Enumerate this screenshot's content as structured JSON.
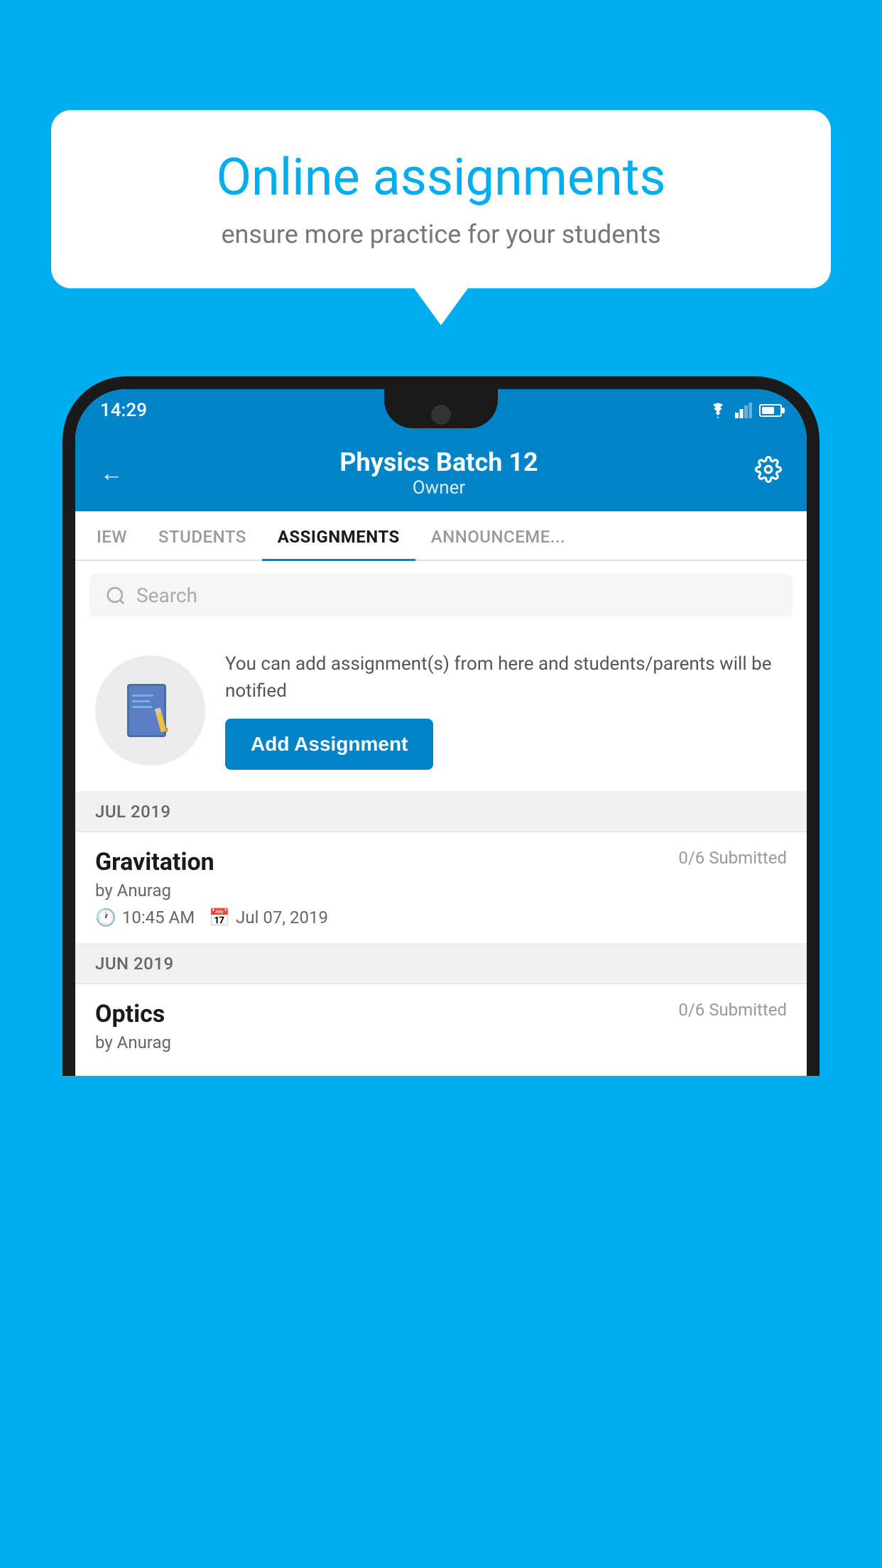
{
  "background_color": "#00AEEF",
  "speech_bubble": {
    "title": "Online assignments",
    "subtitle": "ensure more practice for your students"
  },
  "status_bar": {
    "time": "14:29",
    "wifi": true,
    "signal": true,
    "battery": true
  },
  "header": {
    "title": "Physics Batch 12",
    "subtitle": "Owner",
    "back_label": "←",
    "settings_label": "⚙"
  },
  "tabs": [
    {
      "id": "iew",
      "label": "IEW",
      "active": false
    },
    {
      "id": "students",
      "label": "STUDENTS",
      "active": false
    },
    {
      "id": "assignments",
      "label": "ASSIGNMENTS",
      "active": true
    },
    {
      "id": "announcements",
      "label": "ANNOUNCEMENTS",
      "active": false
    }
  ],
  "search": {
    "placeholder": "Search"
  },
  "info_card": {
    "description": "You can add assignment(s) from here and students/parents will be notified",
    "add_button_label": "Add Assignment"
  },
  "assignment_groups": [
    {
      "month_label": "JUL 2019",
      "assignments": [
        {
          "name": "Gravitation",
          "submitted": "0/6 Submitted",
          "by": "by Anurag",
          "time": "10:45 AM",
          "date": "Jul 07, 2019"
        }
      ]
    },
    {
      "month_label": "JUN 2019",
      "assignments": [
        {
          "name": "Optics",
          "submitted": "0/6 Submitted",
          "by": "by Anurag",
          "time": "",
          "date": ""
        }
      ]
    }
  ]
}
